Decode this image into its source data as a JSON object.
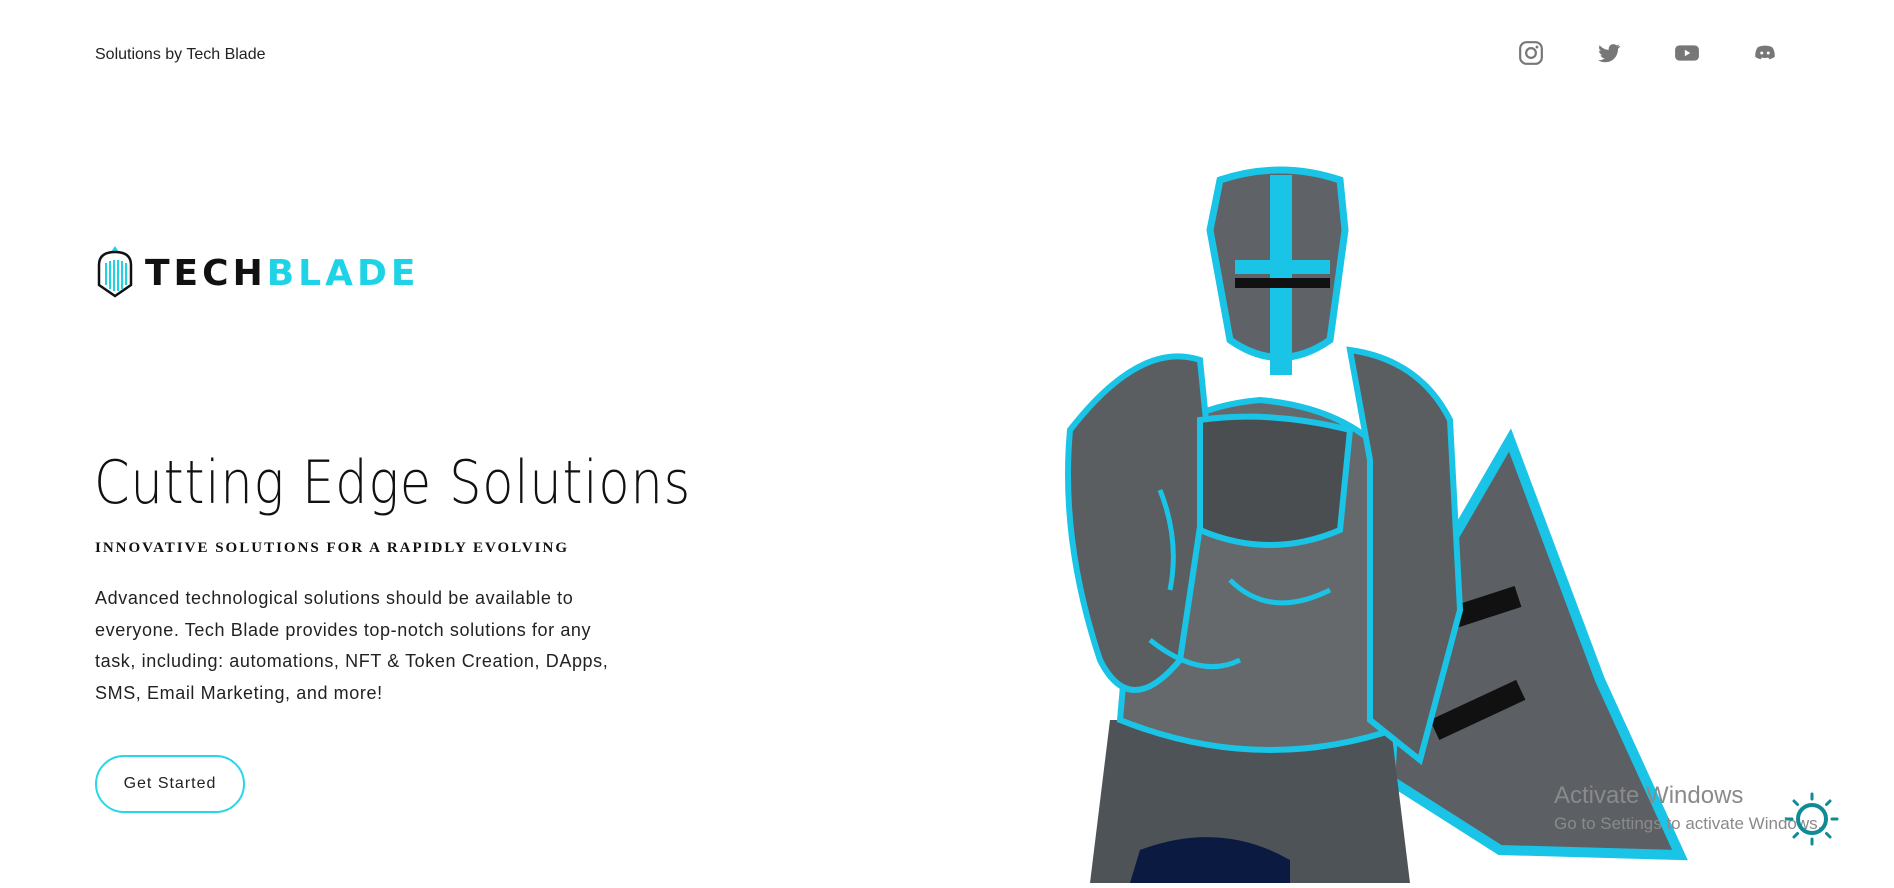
{
  "header": {
    "site_title": "Solutions by Tech Blade",
    "socials": [
      {
        "icon": "instagram-icon"
      },
      {
        "icon": "twitter-icon"
      },
      {
        "icon": "youtube-icon"
      },
      {
        "icon": "discord-icon"
      }
    ]
  },
  "logo": {
    "word_part1": "TECH",
    "word_part2": "BLADE"
  },
  "hero": {
    "title": "Cutting Edge Solutions",
    "subtitle": "INNOVATIVE SOLUTIONS FOR A RAPIDLY EVOLVING",
    "description": "Advanced technological solutions should be available to everyone. Tech Blade provides top-notch solutions for any task, including: automations, NFT & Token Creation, DApps, SMS, Email Marketing, and more!",
    "cta_label": "Get Started"
  },
  "watermark": {
    "line1": "Activate Windows",
    "line2": "Go to Settings to activate Windows."
  },
  "colors": {
    "accent": "#1fd3e6",
    "text": "#111111",
    "armor": "#555a5e"
  }
}
